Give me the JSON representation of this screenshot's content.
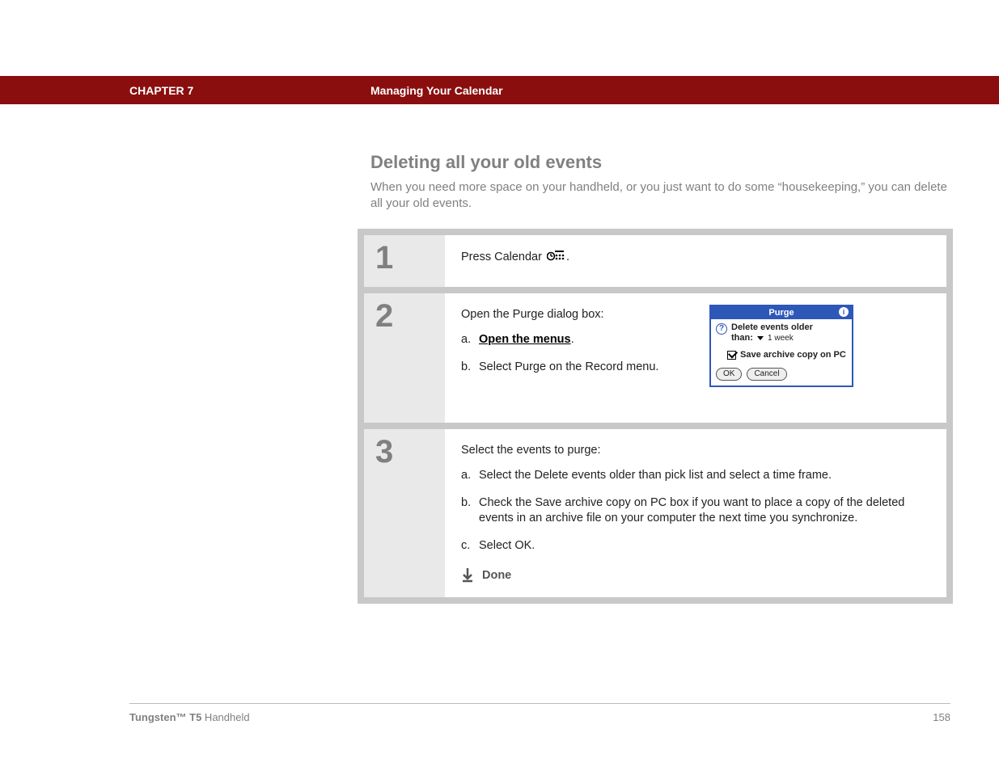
{
  "header": {
    "chapter": "CHAPTER 7",
    "title": "Managing Your Calendar"
  },
  "page": {
    "heading": "Deleting all your old events",
    "intro": "When you need more space on your handheld, or you just want to do some “housekeeping,” you can delete all your old events."
  },
  "steps": [
    {
      "num": "1",
      "lead_before": "Press Calendar ",
      "lead_after": "."
    },
    {
      "num": "2",
      "lead": "Open the Purge dialog box:",
      "items": [
        {
          "letter": "a.",
          "text": "Open the menus",
          "suffix": ".",
          "link": true
        },
        {
          "letter": "b.",
          "text": "Select Purge on the Record menu."
        }
      ]
    },
    {
      "num": "3",
      "lead": "Select the events to purge:",
      "items": [
        {
          "letter": "a.",
          "text": "Select the Delete events older than pick list and select a time frame."
        },
        {
          "letter": "b.",
          "text": "Check the Save archive copy on PC box if you want to place a copy of the deleted events in an archive file on your computer the next time you synchronize."
        },
        {
          "letter": "c.",
          "text": "Select OK."
        }
      ],
      "done": "Done"
    }
  ],
  "dialog": {
    "title": "Purge",
    "line1": "Delete events older",
    "than_label": "than:",
    "duration": "1 week",
    "checkbox_label": "Save archive copy on PC",
    "ok": "OK",
    "cancel": "Cancel"
  },
  "footer": {
    "product_bold": "Tungsten™ T5",
    "product_rest": " Handheld",
    "page_number": "158"
  }
}
